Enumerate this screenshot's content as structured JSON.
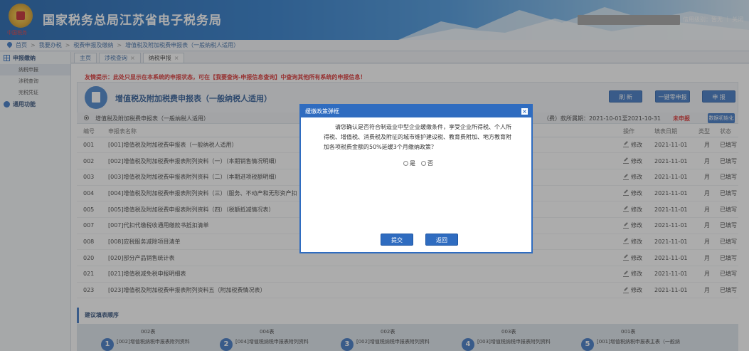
{
  "header": {
    "title": "国家税务总局江苏省电子税务局",
    "emblem_caption": "中国税务",
    "credit_text": "信用级别：暂无 ｜ 关闭"
  },
  "breadcrumb": [
    "首页",
    "我要办税",
    "税费申报及缴纳",
    "增值税及附加税费申报表（一般纳税人适用）"
  ],
  "sidebar": {
    "groups": [
      {
        "label": "申报缴纳",
        "items": [
          "纳税申报",
          "涉税查询",
          "完税凭证"
        ]
      },
      {
        "label": "通用功能",
        "items": []
      }
    ]
  },
  "tabs": [
    {
      "label": "主页",
      "closable": false
    },
    {
      "label": "涉税查询",
      "closable": true
    },
    {
      "label": "纳税申报",
      "closable": true
    }
  ],
  "notice": "友情提示：此处只显示在本系统的申报状态，可在【我要查询-申报信息查询】中查询其他所有系统的申报信息！",
  "form": {
    "title": "增值税及附加税费申报表（一般纳税人适用）",
    "buttons": {
      "refresh": "刷 新",
      "zero": "一键零申报",
      "submit": "申 报"
    },
    "status_label": "增值税及附加税费申报表（一般纳税人适用）",
    "period": "（费）款所属期：2021-10-01至2021-10-31",
    "status": "未申报",
    "init_button": "数据初始化"
  },
  "table": {
    "headers": [
      "编号",
      "申报表名称",
      "操作",
      "填表日期",
      "类型",
      "状态"
    ],
    "rows": [
      {
        "no": "001",
        "name": "[001]增值税及附加税费申报表（一般纳税人适用）",
        "op": "修改",
        "date": "2021-11-01",
        "type": "月",
        "status": "已填写"
      },
      {
        "no": "002",
        "name": "[002]增值税及附加税费申报表附列资料（一）（本期销售情况明细）",
        "op": "修改",
        "date": "2021-11-01",
        "type": "月",
        "status": "已填写"
      },
      {
        "no": "003",
        "name": "[003]增值税及附加税费申报表附列资料（二）（本期进项税额明细）",
        "op": "修改",
        "date": "2021-11-01",
        "type": "月",
        "status": "已填写"
      },
      {
        "no": "004",
        "name": "[004]增值税及附加税费申报表附列资料（三）（服务、不动产和无形资产扣",
        "op": "修改",
        "date": "2021-11-01",
        "type": "月",
        "status": "已填写"
      },
      {
        "no": "005",
        "name": "[005]增值税及附加税费申报表附列资料（四）（税额抵减情况表）",
        "op": "修改",
        "date": "2021-11-01",
        "type": "月",
        "status": "已填写"
      },
      {
        "no": "007",
        "name": "[007]代扣代缴税收通用缴款书抵扣清单",
        "op": "修改",
        "date": "2021-11-01",
        "type": "月",
        "status": "已填写"
      },
      {
        "no": "008",
        "name": "[008]应税服务减除项目清单",
        "op": "修改",
        "date": "2021-11-01",
        "type": "月",
        "status": "已填写"
      },
      {
        "no": "020",
        "name": "[020]部分产品销售统计表",
        "op": "修改",
        "date": "2021-11-01",
        "type": "月",
        "status": "已填写"
      },
      {
        "no": "021",
        "name": "[021]增值税减免税申报明细表",
        "op": "修改",
        "date": "2021-11-01",
        "type": "月",
        "status": "已填写"
      },
      {
        "no": "023",
        "name": "[023]增值税及附加税费申报表附列资料五（附加税费情况表）",
        "op": "修改",
        "date": "2021-11-01",
        "type": "月",
        "status": "已填写"
      }
    ]
  },
  "suggest_title": "建议填表顺序",
  "steps": [
    {
      "num": "1",
      "code": "002表",
      "name": "[002]增值税纳税申报表附列资料"
    },
    {
      "num": "2",
      "code": "004表",
      "name": "[004]增值税纳税申报表附列资料"
    },
    {
      "num": "3",
      "code": "002表",
      "name": "[002]增值税纳税申报表附列资料"
    },
    {
      "num": "4",
      "code": "003表",
      "name": "[003]增值税纳税申报表附列资料"
    },
    {
      "num": "5",
      "code": "001表",
      "name": "[001]增值税纳税申报表主表（一般纳"
    }
  ],
  "modal": {
    "title": "缓缴政策弹框",
    "text": "请您确认是否符合制造业中型企业缓缴条件，享受企业所得税、个人所得税、增值税、消费税及附征的城市维护建设税、教育费附加、地方教育附加各项税费金额的50%延缓3个月缴纳政策？",
    "options": [
      "是",
      "否"
    ],
    "submit": "提交",
    "back": "返回"
  },
  "colors": {
    "primary": "#2f6cc0",
    "warning": "#d9201f",
    "filled": "#e08a00"
  }
}
